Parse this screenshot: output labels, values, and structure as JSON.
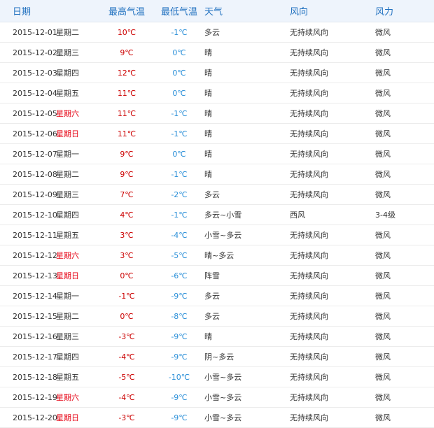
{
  "headers": {
    "date": "日期",
    "high": "最高气温",
    "low": "最低气温",
    "weather": "天气",
    "wind_dir": "风向",
    "wind_power": "风力"
  },
  "colors": {
    "header_text": "#1e6fbf",
    "header_bg": "#eef4fc",
    "high_temp": "#cc0000",
    "low_temp": "#2a8fd8",
    "weekend": "#e60012"
  },
  "rows": [
    {
      "date": "2015-12-01",
      "weekday": "星期二",
      "weekend": false,
      "high": "10℃",
      "low": "-1℃",
      "weather": "多云",
      "wind_dir": "无持续风向",
      "wind_power": "微风"
    },
    {
      "date": "2015-12-02",
      "weekday": "星期三",
      "weekend": false,
      "high": "9℃",
      "low": "0℃",
      "weather": "晴",
      "wind_dir": "无持续风向",
      "wind_power": "微风"
    },
    {
      "date": "2015-12-03",
      "weekday": "星期四",
      "weekend": false,
      "high": "12℃",
      "low": "0℃",
      "weather": "晴",
      "wind_dir": "无持续风向",
      "wind_power": "微风"
    },
    {
      "date": "2015-12-04",
      "weekday": "星期五",
      "weekend": false,
      "high": "11℃",
      "low": "0℃",
      "weather": "晴",
      "wind_dir": "无持续风向",
      "wind_power": "微风"
    },
    {
      "date": "2015-12-05",
      "weekday": "星期六",
      "weekend": true,
      "high": "11℃",
      "low": "-1℃",
      "weather": "晴",
      "wind_dir": "无持续风向",
      "wind_power": "微风"
    },
    {
      "date": "2015-12-06",
      "weekday": "星期日",
      "weekend": true,
      "high": "11℃",
      "low": "-1℃",
      "weather": "晴",
      "wind_dir": "无持续风向",
      "wind_power": "微风"
    },
    {
      "date": "2015-12-07",
      "weekday": "星期一",
      "weekend": false,
      "high": "9℃",
      "low": "0℃",
      "weather": "晴",
      "wind_dir": "无持续风向",
      "wind_power": "微风"
    },
    {
      "date": "2015-12-08",
      "weekday": "星期二",
      "weekend": false,
      "high": "9℃",
      "low": "-1℃",
      "weather": "晴",
      "wind_dir": "无持续风向",
      "wind_power": "微风"
    },
    {
      "date": "2015-12-09",
      "weekday": "星期三",
      "weekend": false,
      "high": "7℃",
      "low": "-2℃",
      "weather": "多云",
      "wind_dir": "无持续风向",
      "wind_power": "微风"
    },
    {
      "date": "2015-12-10",
      "weekday": "星期四",
      "weekend": false,
      "high": "4℃",
      "low": "-1℃",
      "weather": "多云~小雪",
      "wind_dir": "西风",
      "wind_power": "3-4级"
    },
    {
      "date": "2015-12-11",
      "weekday": "星期五",
      "weekend": false,
      "high": "3℃",
      "low": "-4℃",
      "weather": "小雪~多云",
      "wind_dir": "无持续风向",
      "wind_power": "微风"
    },
    {
      "date": "2015-12-12",
      "weekday": "星期六",
      "weekend": true,
      "high": "3℃",
      "low": "-5℃",
      "weather": "晴~多云",
      "wind_dir": "无持续风向",
      "wind_power": "微风"
    },
    {
      "date": "2015-12-13",
      "weekday": "星期日",
      "weekend": true,
      "high": "0℃",
      "low": "-6℃",
      "weather": "阵雪",
      "wind_dir": "无持续风向",
      "wind_power": "微风"
    },
    {
      "date": "2015-12-14",
      "weekday": "星期一",
      "weekend": false,
      "high": "-1℃",
      "low": "-9℃",
      "weather": "多云",
      "wind_dir": "无持续风向",
      "wind_power": "微风"
    },
    {
      "date": "2015-12-15",
      "weekday": "星期二",
      "weekend": false,
      "high": "0℃",
      "low": "-8℃",
      "weather": "多云",
      "wind_dir": "无持续风向",
      "wind_power": "微风"
    },
    {
      "date": "2015-12-16",
      "weekday": "星期三",
      "weekend": false,
      "high": "-3℃",
      "low": "-9℃",
      "weather": "晴",
      "wind_dir": "无持续风向",
      "wind_power": "微风"
    },
    {
      "date": "2015-12-17",
      "weekday": "星期四",
      "weekend": false,
      "high": "-4℃",
      "low": "-9℃",
      "weather": "阴~多云",
      "wind_dir": "无持续风向",
      "wind_power": "微风"
    },
    {
      "date": "2015-12-18",
      "weekday": "星期五",
      "weekend": false,
      "high": "-5℃",
      "low": "-10℃",
      "weather": "小雪~多云",
      "wind_dir": "无持续风向",
      "wind_power": "微风"
    },
    {
      "date": "2015-12-19",
      "weekday": "星期六",
      "weekend": true,
      "high": "-4℃",
      "low": "-9℃",
      "weather": "小雪~多云",
      "wind_dir": "无持续风向",
      "wind_power": "微风"
    },
    {
      "date": "2015-12-20",
      "weekday": "星期日",
      "weekend": true,
      "high": "-3℃",
      "low": "-9℃",
      "weather": "小雪~多云",
      "wind_dir": "无持续风向",
      "wind_power": "微风"
    }
  ]
}
